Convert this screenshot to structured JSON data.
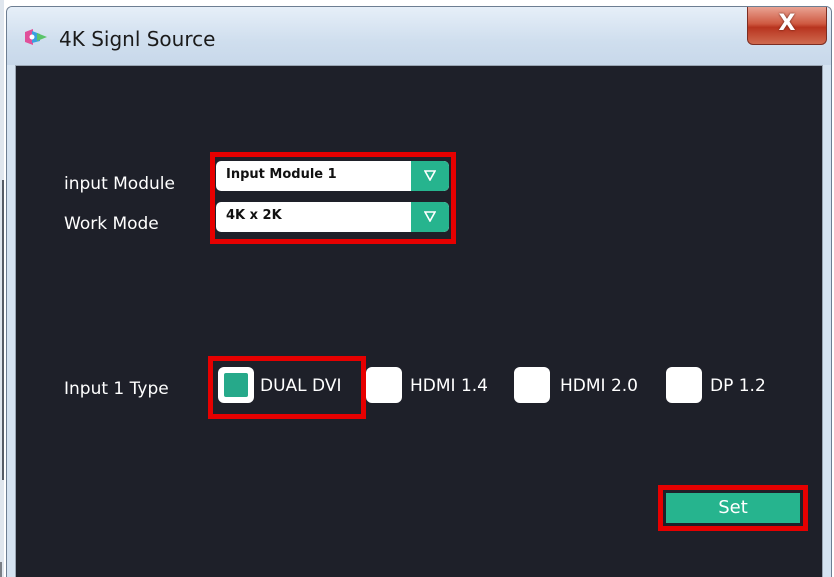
{
  "window": {
    "title": "4K Signl Source",
    "close_label": "X"
  },
  "form": {
    "input_module": {
      "label": "input Module",
      "value": "Input Module 1"
    },
    "work_mode": {
      "label": "Work Mode",
      "value": "4K x 2K"
    },
    "input_type": {
      "label": "Input 1 Type",
      "options": [
        {
          "label": "DUAL DVI",
          "checked": true
        },
        {
          "label": "HDMI 1.4",
          "checked": false
        },
        {
          "label": "HDMI 2.0",
          "checked": false
        },
        {
          "label": "DP 1.2",
          "checked": false
        }
      ]
    },
    "set_label": "Set"
  },
  "icons": {
    "app": "app-logo-icon",
    "dropdown": "triangle-down-icon"
  },
  "colors": {
    "accent": "#26b48e",
    "highlight": "#e60000",
    "background": "#1e2029",
    "close": "#c94a33"
  }
}
